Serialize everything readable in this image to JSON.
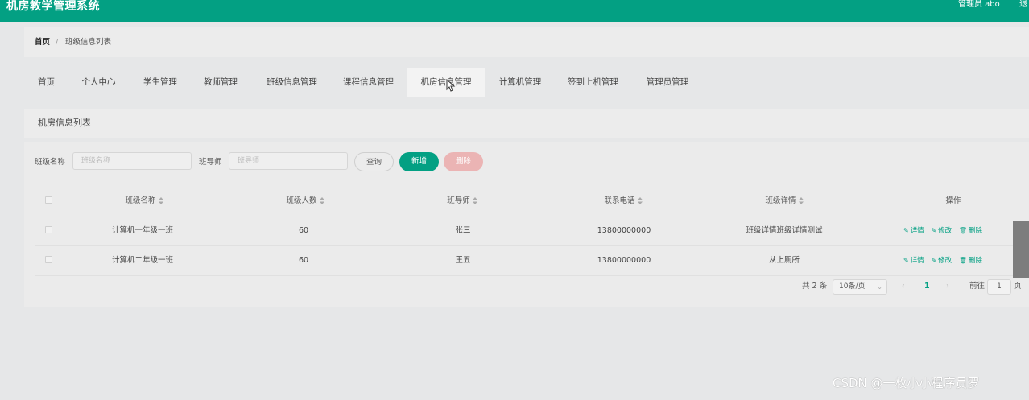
{
  "app": {
    "title": "机房教学管理系统",
    "admin": "管理员 abo",
    "logout": "退"
  },
  "breadcrumb": {
    "home": "首页",
    "separator": "/",
    "current": "班级信息列表"
  },
  "nav": {
    "items": [
      {
        "label": "首页"
      },
      {
        "label": "个人中心"
      },
      {
        "label": "学生管理"
      },
      {
        "label": "教师管理"
      },
      {
        "label": "班级信息管理"
      },
      {
        "label": "课程信息管理"
      },
      {
        "label": "机房信息管理"
      },
      {
        "label": "计算机管理"
      },
      {
        "label": "签到上机管理"
      },
      {
        "label": "管理员管理"
      }
    ],
    "active_index": 6
  },
  "panel": {
    "title": "机房信息列表"
  },
  "search": {
    "class_name_label": "班级名称",
    "class_name_placeholder": "班级名称",
    "teacher_label": "班导师",
    "teacher_placeholder": "班导师",
    "query_label": "查询",
    "add_label": "新增",
    "delete_label": "删除"
  },
  "table": {
    "headers": [
      "班级名称",
      "班级人数",
      "班导师",
      "联系电话",
      "班级详情",
      "操作"
    ],
    "rows": [
      {
        "name": "计算机一年级一班",
        "count": "60",
        "teacher": "张三",
        "phone": "13800000000",
        "detail": "班级详情班级详情测试"
      },
      {
        "name": "计算机二年级一班",
        "count": "60",
        "teacher": "王五",
        "phone": "13800000000",
        "detail": "从上厕所"
      }
    ],
    "ops": {
      "detail": "详情",
      "edit": "修改",
      "delete": "删除"
    }
  },
  "pagination": {
    "total": "共 2 条",
    "page_size": "10条/页",
    "current_page": "1",
    "goto_label": "前往",
    "goto_value": "1",
    "page_suffix": "页"
  },
  "watermark": "CSDN @一枚小小程序员罗",
  "colors": {
    "brand": "#03a083",
    "danger_light": "#ebb4b4"
  }
}
